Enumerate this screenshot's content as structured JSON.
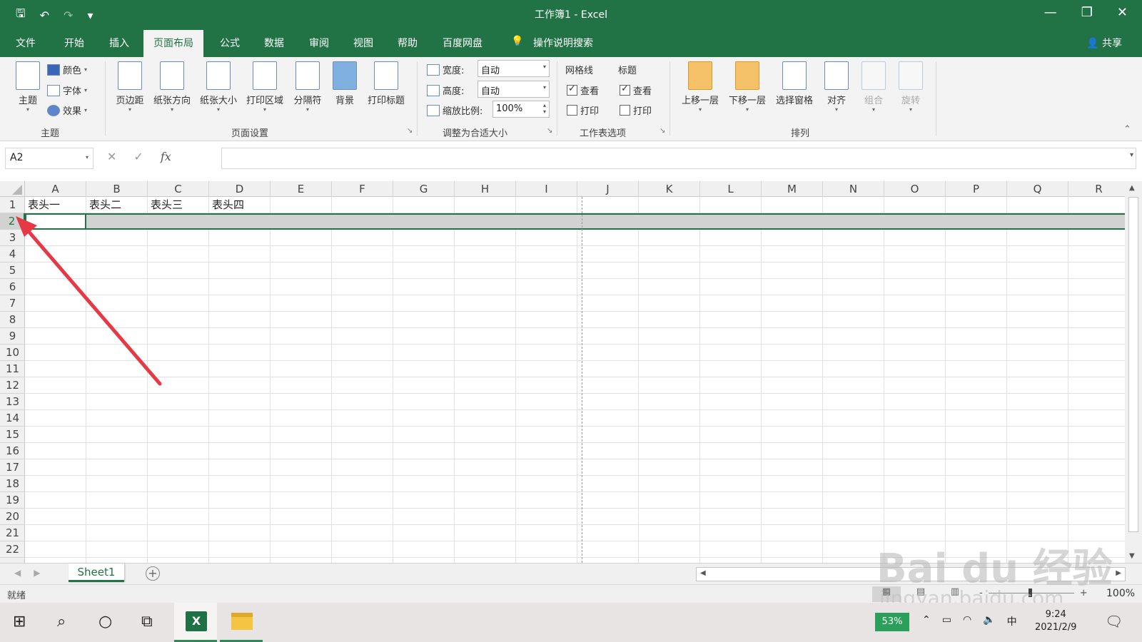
{
  "window": {
    "title": "工作簿1  -  Excel",
    "qat": {
      "save": "🖫",
      "undo": "↶",
      "undo_dd": "▾",
      "redo": "↷",
      "redo_dd": "▾",
      "customize": "▾"
    },
    "controls": {
      "minimize": "—",
      "restore": "❐",
      "close": "✕"
    }
  },
  "ribbon_tabs": [
    "文件",
    "开始",
    "插入",
    "页面布局",
    "公式",
    "数据",
    "审阅",
    "视图",
    "帮助",
    "百度网盘"
  ],
  "active_tab": "页面布局",
  "tell_me": "操作说明搜索",
  "share": "共享",
  "groups": {
    "theme": {
      "label": "主题",
      "theme_btn": "主题",
      "colors": "颜色",
      "fonts": "字体",
      "effects": "效果"
    },
    "page_setup": {
      "label": "页面设置",
      "margins": "页边距",
      "orientation": "纸张方向",
      "size": "纸张大小",
      "print_area": "打印区域",
      "breaks": "分隔符",
      "background": "背景",
      "print_titles": "打印标题"
    },
    "scale_to_fit": {
      "label": "调整为合适大小",
      "width_label": "宽度:",
      "width_value": "自动",
      "height_label": "高度:",
      "height_value": "自动",
      "scale_label": "缩放比例:",
      "scale_value": "100%"
    },
    "sheet_options": {
      "label": "工作表选项",
      "gridlines": "网格线",
      "headings": "标题",
      "view": "查看",
      "print": "打印",
      "gridlines_view": true,
      "gridlines_print": false,
      "headings_view": true,
      "headings_print": false
    },
    "arrange": {
      "label": "排列",
      "bring_forward": "上移一层",
      "send_backward": "下移一层",
      "selection_pane": "选择窗格",
      "align": "对齐",
      "group": "组合",
      "rotate": "旋转"
    }
  },
  "formula_bar": {
    "name_box": "A2",
    "cancel": "✕",
    "enter": "✓",
    "fx": "fx",
    "value": ""
  },
  "grid": {
    "columns": [
      "A",
      "B",
      "C",
      "D",
      "E",
      "F",
      "G",
      "H",
      "I",
      "J",
      "K",
      "L",
      "M",
      "N",
      "O",
      "P",
      "Q",
      "R"
    ],
    "rows": [
      "1",
      "2",
      "3",
      "4",
      "5",
      "6",
      "7",
      "8",
      "9",
      "10",
      "11",
      "12",
      "13",
      "14",
      "15",
      "16",
      "17",
      "18",
      "19",
      "20",
      "21",
      "22"
    ],
    "row1": [
      "表头一",
      "表头二",
      "表头三",
      "表头四"
    ],
    "selected_row": "2",
    "active_cell": "A2"
  },
  "sheets": {
    "tabs": [
      "Sheet1"
    ],
    "add": "+"
  },
  "status": {
    "ready": "就绪",
    "zoom": "100%",
    "zoom_minus": "-",
    "zoom_plus": "+"
  },
  "taskbar": {
    "battery": "53%",
    "ime": "中",
    "time": "9:24",
    "date": "2021/2/9"
  },
  "watermark": {
    "brand": "Bai du 经验",
    "url": "jingyan.baidu.com"
  },
  "colors": {
    "excel_green": "#217346",
    "arrow": "#e53946"
  }
}
